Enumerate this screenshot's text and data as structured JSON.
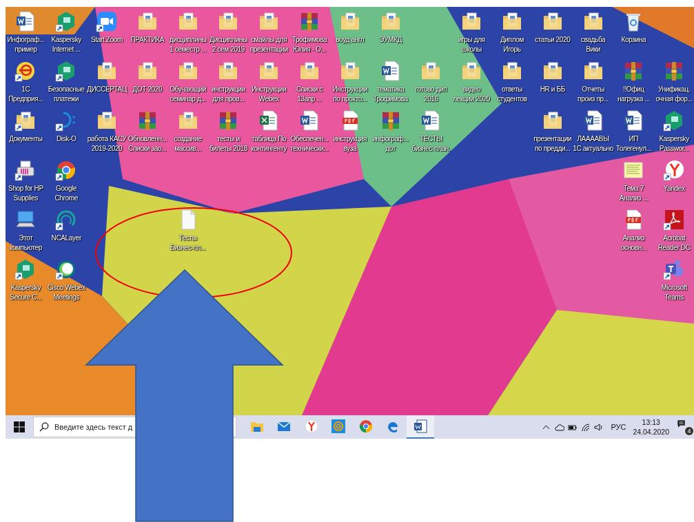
{
  "desktop": {
    "rows": [
      [
        {
          "label": [
            "Инфограф...",
            "пример"
          ],
          "kind": "word",
          "shortcut": false
        },
        {
          "label": [
            "Kaspersky",
            "Internet ..."
          ],
          "kind": "kaspersky",
          "shortcut": true
        },
        {
          "label": [
            "Start Zoom"
          ],
          "kind": "zoom",
          "shortcut": true
        },
        {
          "label": [
            "ПРАКТИКА"
          ],
          "kind": "folder",
          "shortcut": false
        },
        {
          "label": [
            "дисциплины",
            "1 семестр ..."
          ],
          "kind": "folder",
          "shortcut": false
        },
        {
          "label": [
            "Дисциплины",
            "2 сем 2019"
          ],
          "kind": "folder",
          "shortcut": false
        },
        {
          "label": [
            "смайлы для",
            "презентации"
          ],
          "kind": "folder",
          "shortcut": false
        },
        {
          "label": [
            "Трофимова",
            "Юлия  - О..."
          ],
          "kind": "archive",
          "shortcut": false
        },
        {
          "label": [
            "воуд англ"
          ],
          "kind": "folder",
          "shortcut": false
        },
        {
          "label": [
            "ЭУМКД"
          ],
          "kind": "folder",
          "shortcut": false
        },
        null,
        {
          "label": [
            "игры для",
            "школы"
          ],
          "kind": "folder",
          "shortcut": false
        },
        {
          "label": [
            "Диплом",
            "Игорь"
          ],
          "kind": "folder",
          "shortcut": false
        },
        {
          "label": [
            "статьи 2020"
          ],
          "kind": "folder",
          "shortcut": false
        },
        {
          "label": [
            "свадьба",
            "Вики"
          ],
          "kind": "folder",
          "shortcut": false
        },
        {
          "label": [
            "Корзина"
          ],
          "kind": "bin",
          "shortcut": false
        },
        null
      ],
      [
        {
          "label": [
            "1С",
            "Предприя..."
          ],
          "kind": "onec",
          "shortcut": true
        },
        {
          "label": [
            "Безопасные",
            "платежи"
          ],
          "kind": "kaspersky",
          "shortcut": true
        },
        {
          "label": [
            "ДИССЕРТАЦ"
          ],
          "kind": "folder",
          "shortcut": false
        },
        {
          "label": [
            "ДОТ 2020"
          ],
          "kind": "folder",
          "shortcut": false
        },
        {
          "label": [
            "Обучающий",
            "семинар д..."
          ],
          "kind": "folder",
          "shortcut": false
        },
        {
          "label": [
            "инструкции",
            "для пров..."
          ],
          "kind": "folder",
          "shortcut": false
        },
        {
          "label": [
            "Инструкции",
            "Webex"
          ],
          "kind": "folder",
          "shortcut": false
        },
        {
          "label": [
            "Списки с",
            "13апр ..."
          ],
          "kind": "folder",
          "shortcut": false
        },
        {
          "label": [
            "Инструкции",
            "по прокто..."
          ],
          "kind": "folder",
          "shortcut": false
        },
        {
          "label": [
            "тематика",
            "Трофимова"
          ],
          "kind": "word",
          "shortcut": false
        },
        {
          "label": [
            "готово дип",
            "2016"
          ],
          "kind": "folder",
          "shortcut": false
        },
        {
          "label": [
            "видео",
            "лекции 2020"
          ],
          "kind": "folder",
          "shortcut": false
        },
        {
          "label": [
            "ответы",
            "студентов"
          ],
          "kind": "folder",
          "shortcut": false
        },
        {
          "label": [
            "HR и ББ"
          ],
          "kind": "folder",
          "shortcut": false
        },
        {
          "label": [
            "Отчеты",
            "произ пр..."
          ],
          "kind": "folder",
          "shortcut": false
        },
        {
          "label": [
            "!!Офиц",
            "нагрузка ..."
          ],
          "kind": "archive",
          "shortcut": false
        },
        {
          "label": [
            "Унификац.",
            "очная фор..."
          ],
          "kind": "archive",
          "shortcut": false
        }
      ],
      [
        {
          "label": [
            "Документы"
          ],
          "kind": "folder",
          "shortcut": true
        },
        {
          "label": [
            "Disk-O"
          ],
          "kind": "disko",
          "shortcut": true
        },
        {
          "label": [
            "работа КАСУ",
            "2019-2020"
          ],
          "kind": "folder",
          "shortcut": false
        },
        {
          "label": [
            "Обновленн...",
            "Списки зао..."
          ],
          "kind": "archive",
          "shortcut": false
        },
        {
          "label": [
            "создание",
            "массив..."
          ],
          "kind": "folder",
          "shortcut": false
        },
        {
          "label": [
            "тесты и",
            "билеты 2018"
          ],
          "kind": "archive",
          "shortcut": false
        },
        {
          "label": [
            "таблица По",
            "контингенту"
          ],
          "kind": "excel",
          "shortcut": false
        },
        {
          "label": [
            "Обеспечен...",
            "технически..."
          ],
          "kind": "word",
          "shortcut": false
        },
        {
          "label": [
            "инструкция",
            "вуза"
          ],
          "kind": "pdf",
          "shortcut": false
        },
        {
          "label": [
            "инфограф...",
            "дот"
          ],
          "kind": "archive",
          "shortcut": false
        },
        {
          "label": [
            "ТЕСТЫ",
            "бизнес-план."
          ],
          "kind": "word",
          "shortcut": false
        },
        null,
        null,
        {
          "label": [
            "презентации",
            "по предди..."
          ],
          "kind": "folder",
          "shortcut": false
        },
        {
          "label": [
            "ЛААААВЫ",
            "1С актуально"
          ],
          "kind": "word",
          "shortcut": false
        },
        {
          "label": [
            "ИП",
            "Толегенул..."
          ],
          "kind": "word",
          "shortcut": false
        },
        {
          "label": [
            "Kaspersky",
            "Passwor..."
          ],
          "kind": "kaspersky",
          "shortcut": true
        }
      ],
      [
        {
          "label": [
            "Shop for HP",
            "Supplies"
          ],
          "kind": "printer",
          "shortcut": true
        },
        {
          "label": [
            "Google",
            "Chrome"
          ],
          "kind": "chrome",
          "shortcut": true
        },
        null,
        null,
        null,
        null,
        null,
        null,
        null,
        null,
        null,
        null,
        null,
        null,
        null,
        {
          "label": [
            "Тема 7",
            "Анализ ..."
          ],
          "kind": "note",
          "shortcut": false
        },
        {
          "label": [
            "Yandex"
          ],
          "kind": "yandex",
          "shortcut": true
        }
      ],
      [
        {
          "label": [
            "Этот",
            "компьютер"
          ],
          "kind": "computer",
          "shortcut": false
        },
        {
          "label": [
            "NCALayer"
          ],
          "kind": "ncalayer",
          "shortcut": true
        },
        null,
        null,
        {
          "label": [
            "Тесты",
            "Бизнес-пл..."
          ],
          "kind": "file",
          "shortcut": false
        },
        null,
        null,
        null,
        null,
        null,
        null,
        null,
        null,
        null,
        null,
        {
          "label": [
            "Анализ",
            "основн..."
          ],
          "kind": "pdf",
          "shortcut": false
        },
        {
          "label": [
            "Acrobat",
            "Reader DC"
          ],
          "kind": "acrobat",
          "shortcut": true
        }
      ],
      [
        {
          "label": [
            "Kaspersky",
            "Secure C..."
          ],
          "kind": "kaspersky",
          "shortcut": true
        },
        {
          "label": [
            "Cisco Webex",
            "Meetings"
          ],
          "kind": "webex",
          "shortcut": true
        },
        null,
        null,
        null,
        null,
        null,
        null,
        null,
        null,
        null,
        null,
        null,
        null,
        null,
        null,
        {
          "label": [
            "Microsoft",
            "Teams"
          ],
          "kind": "teams",
          "shortcut": true
        }
      ]
    ]
  },
  "taskbar": {
    "search": {
      "placeholder": "Введите здесь текст д"
    },
    "apps": [
      {
        "kind": "explorer",
        "active": false
      },
      {
        "kind": "mail",
        "active": false
      },
      {
        "kind": "yandex",
        "active": false
      },
      {
        "kind": "at",
        "active": false
      },
      {
        "kind": "chrome",
        "active": false
      },
      {
        "kind": "edge",
        "active": false
      },
      {
        "kind": "word",
        "active": true
      }
    ],
    "language": "РУС",
    "time": "13:13",
    "date": "24.04.2020",
    "notifications": "4"
  }
}
